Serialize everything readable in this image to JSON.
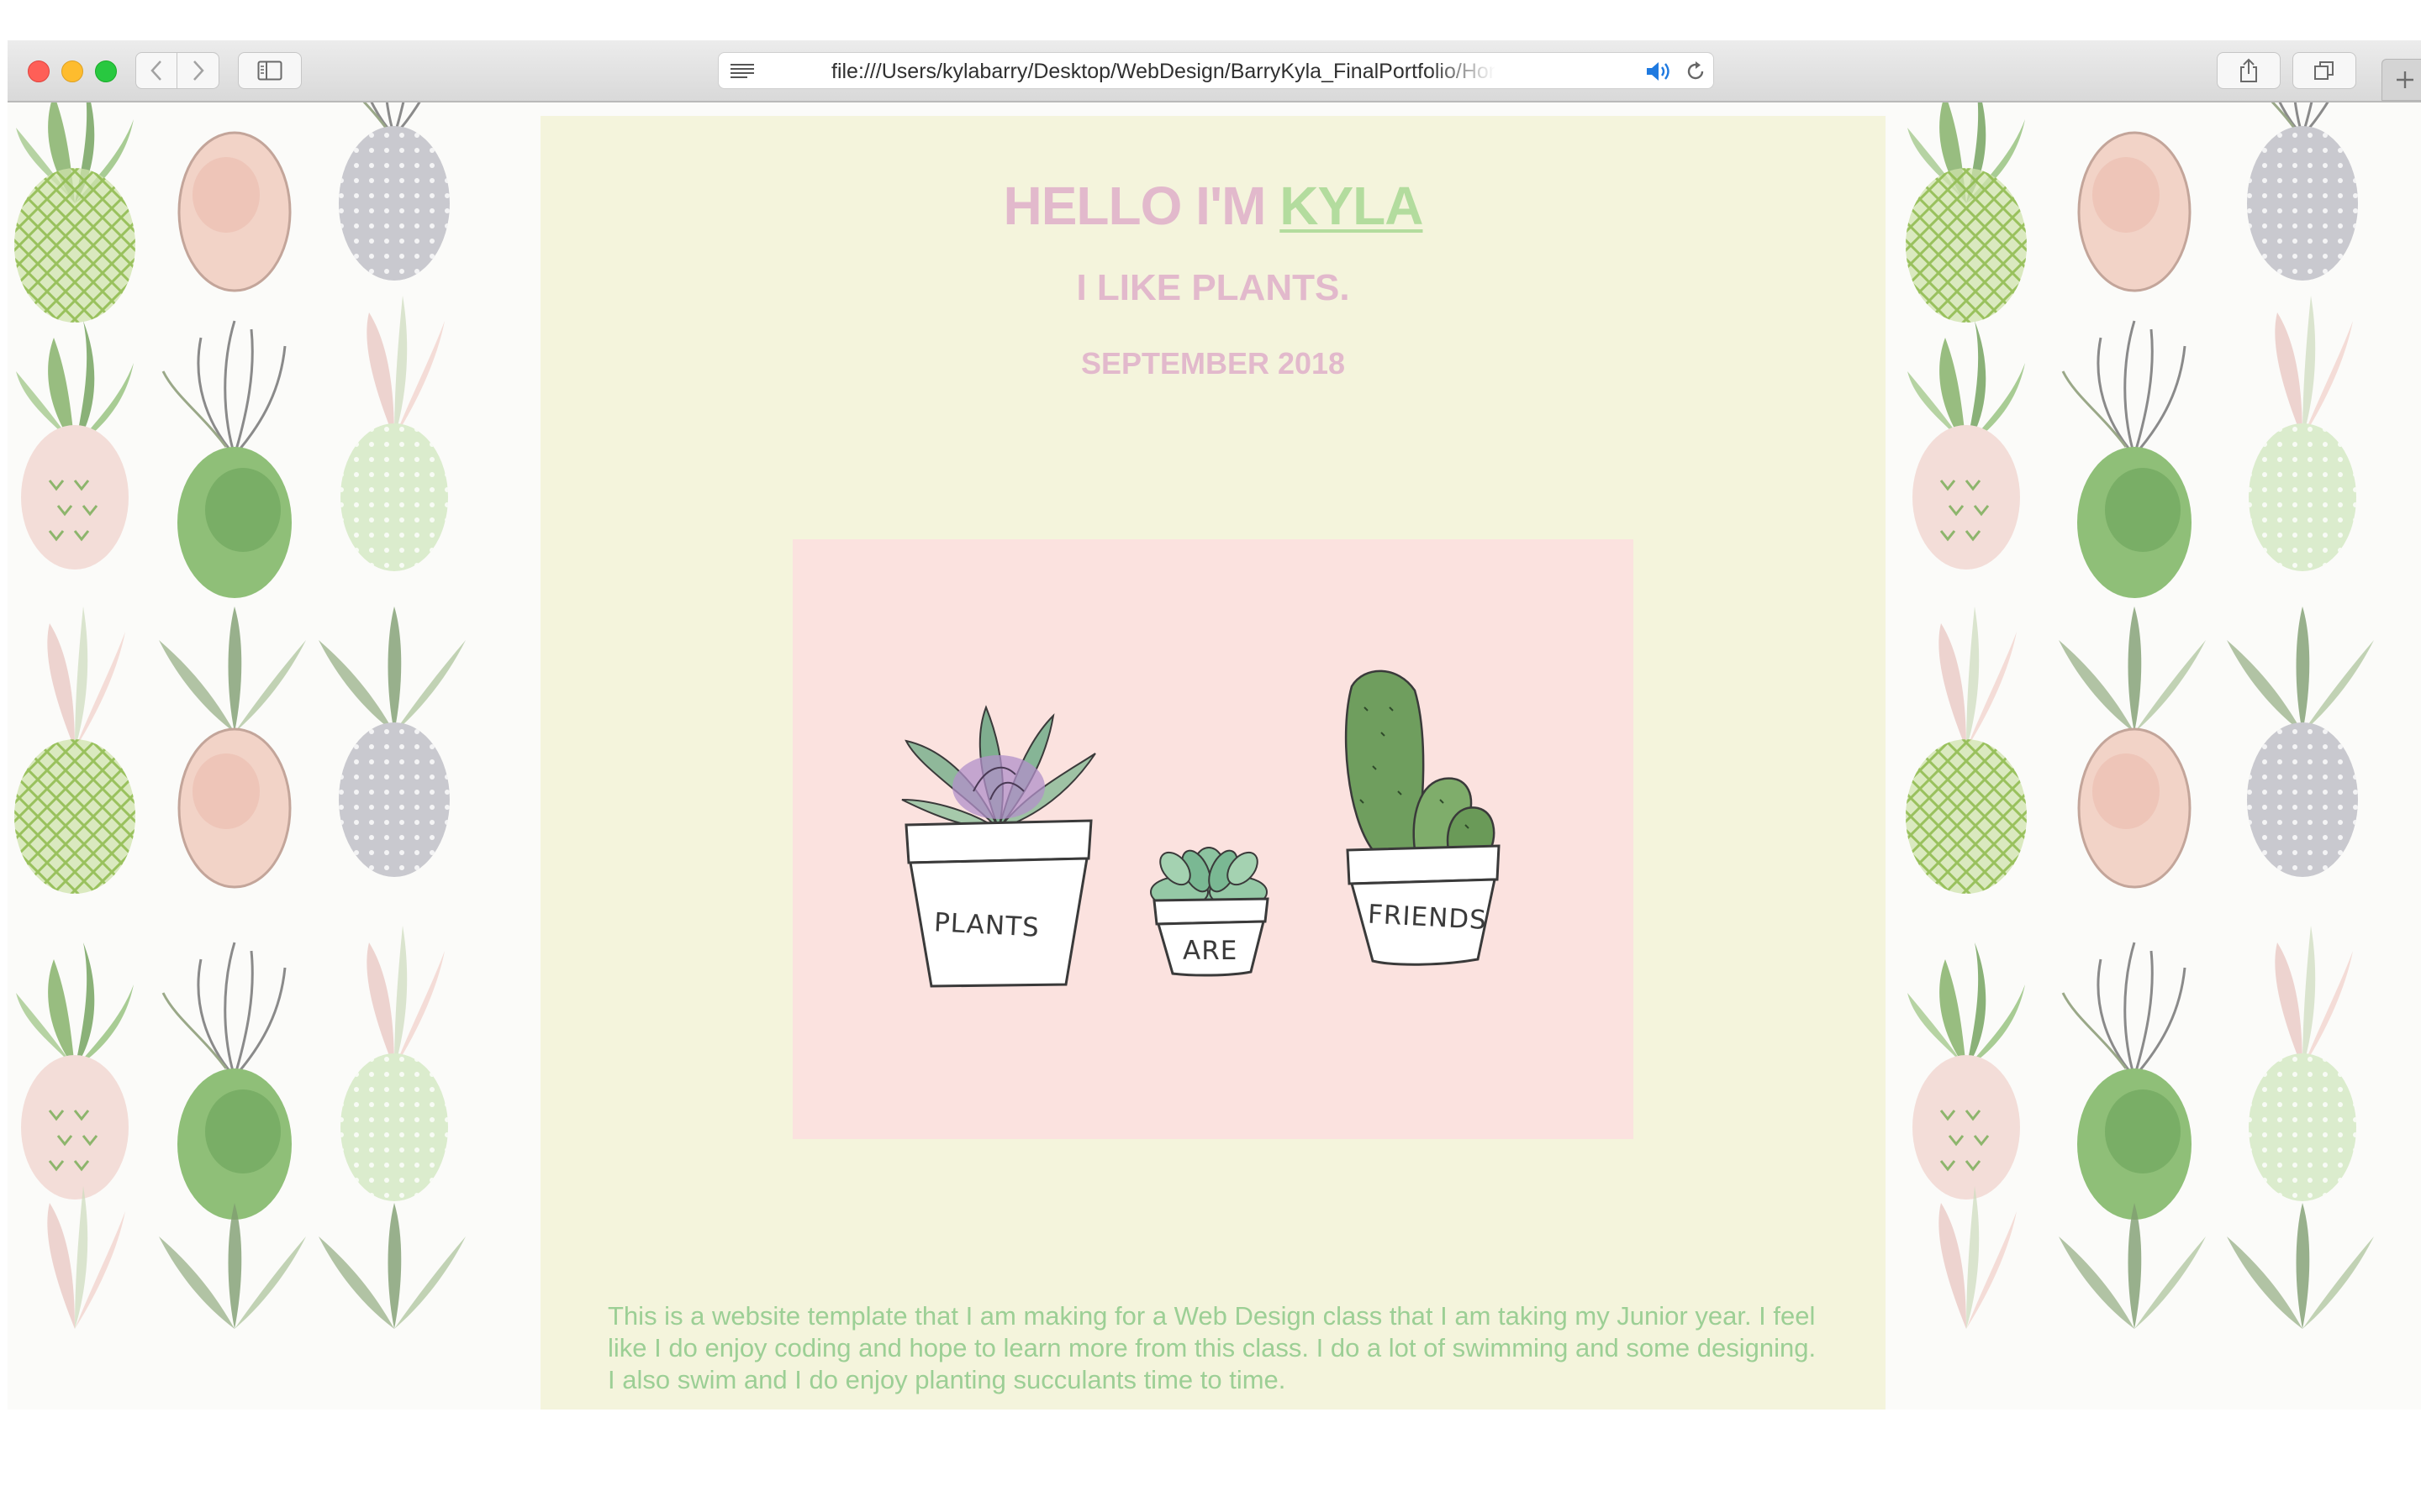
{
  "browser": {
    "url": "file:///Users/kylabarry/Desktop/WebDesign/BarryKyla_FinalPortfolio/Homepage/Index.html"
  },
  "page": {
    "heading_prefix": "HELLO I'M ",
    "heading_name": "KYLA",
    "tagline": "I LIKE PLANTS.",
    "date": "SEPTEMBER 2018",
    "image": {
      "pot_labels": [
        "PLANTS",
        "ARE",
        "FRIENDS"
      ]
    },
    "about_text": "This is a website template that I am making for a Web Design class that I am taking my Junior year. I feel like I do enjoy coding and hope to learn more from this class. I do a lot of swimming and some designing. I also swim and I do enjoy planting succulants time to time."
  },
  "colors": {
    "panel_bg": "#f4f4dc",
    "heading_pink": "#e2b9cc",
    "link_green": "#b3dc9e",
    "art_bg": "#fbe2df",
    "body_text_green": "#9ccf95"
  },
  "icons": {
    "reader": "reader-view-icon",
    "audio": "speaker-icon",
    "reload": "reload-icon",
    "share": "share-icon",
    "tabs": "tab-overview-icon",
    "new_tab": "plus-icon"
  }
}
